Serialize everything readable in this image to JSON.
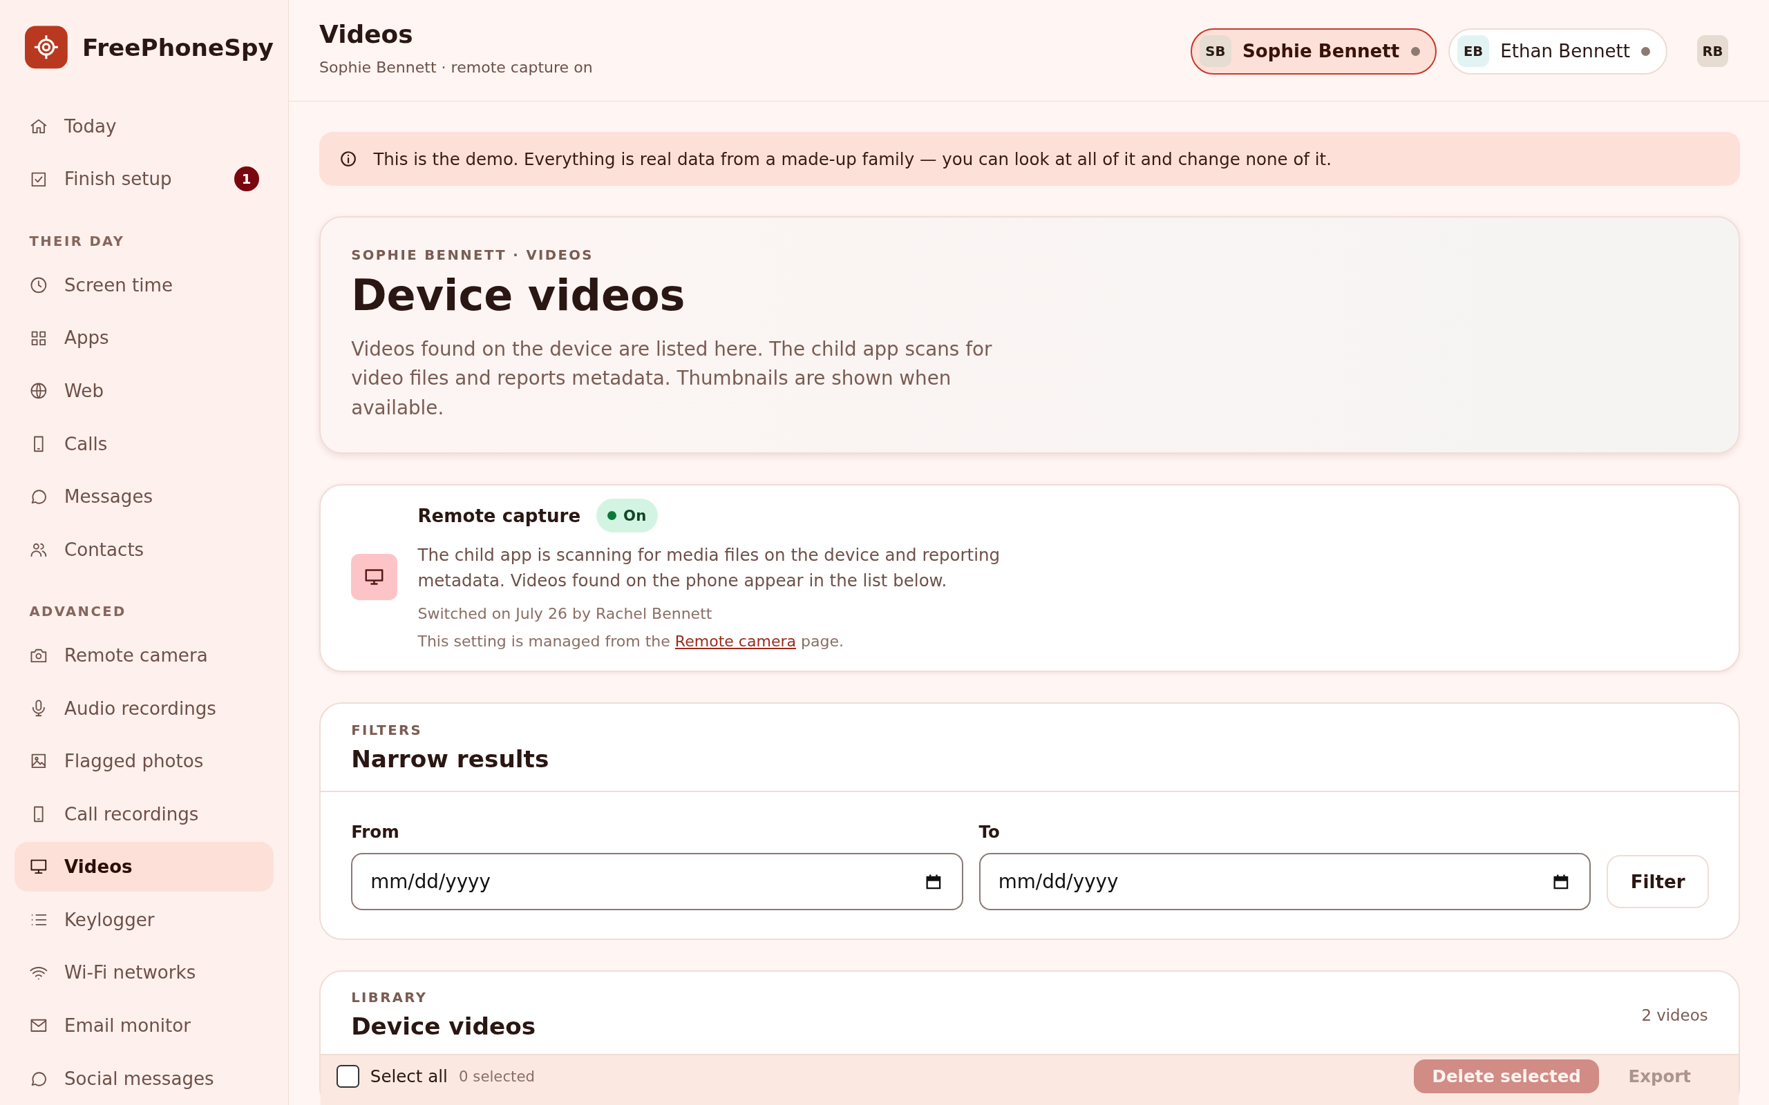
{
  "brand": {
    "name": "FreePhoneSpy"
  },
  "sidebar": {
    "groups": [
      {
        "items": [
          {
            "label": "Today",
            "selected": false
          },
          {
            "label": "Finish setup",
            "selected": false,
            "badge": "1"
          }
        ]
      },
      {
        "heading": "THEIR DAY",
        "items": [
          {
            "label": "Screen time",
            "selected": false
          },
          {
            "label": "Apps",
            "selected": false
          },
          {
            "label": "Web",
            "selected": false
          },
          {
            "label": "Calls",
            "selected": false
          },
          {
            "label": "Messages",
            "selected": false
          },
          {
            "label": "Contacts",
            "selected": false
          }
        ]
      },
      {
        "heading": "ADVANCED",
        "items": [
          {
            "label": "Remote camera",
            "selected": false
          },
          {
            "label": "Audio recordings",
            "selected": false
          },
          {
            "label": "Flagged photos",
            "selected": false
          },
          {
            "label": "Call recordings",
            "selected": false
          },
          {
            "label": "Videos",
            "selected": true
          },
          {
            "label": "Keylogger",
            "selected": false
          },
          {
            "label": "Wi-Fi networks",
            "selected": false
          },
          {
            "label": "Email monitor",
            "selected": false
          },
          {
            "label": "Social messages",
            "selected": false
          }
        ]
      }
    ]
  },
  "header": {
    "title": "Videos",
    "subtitle": "Sophie Bennett · remote capture on",
    "profiles": [
      {
        "initials": "SB",
        "name": "Sophie Bennett",
        "selected": true,
        "color": "#e6dcd2"
      },
      {
        "initials": "EB",
        "name": "Ethan Bennett",
        "selected": false,
        "color": "#e2f3f3"
      }
    ],
    "user": {
      "initials": "RB"
    }
  },
  "notice": {
    "text": "This is the demo. Everything is real data from a made-up family — you can look at all of it and change none of it."
  },
  "hero": {
    "eyebrow": "SOPHIE BENNETT · VIDEOS",
    "title": "Device videos",
    "description": "Videos found on the device are listed here. The child app scans for video files and reports metadata. Thumbnails are shown when available."
  },
  "capture": {
    "title": "Remote capture",
    "status": {
      "label": "On",
      "on": true
    },
    "description": "The child app is scanning for media files on the device and reporting metadata. Videos found on the phone appear in the list below.",
    "meta": "Switched on July 26 by Rachel Bennett",
    "note_before": "This setting is managed from the",
    "link": "Remote camera",
    "note_after": "page."
  },
  "filters": {
    "eyebrow": "FILTERS",
    "title": "Narrow results",
    "fields": [
      {
        "label": "From",
        "placeholder": "mm/dd/yyyy"
      },
      {
        "label": "To",
        "placeholder": "mm/dd/yyyy"
      }
    ],
    "button": "Filter"
  },
  "library": {
    "eyebrow": "LIBRARY",
    "title": "Device videos",
    "count": "2 videos",
    "select_all": {
      "label": "Select all",
      "checked": false
    },
    "selected_count": "0 selected",
    "buttons": [
      {
        "label": "Delete selected",
        "kind": "danger",
        "disabled": true
      },
      {
        "label": "Export",
        "kind": "plain",
        "disabled": true
      }
    ]
  }
}
